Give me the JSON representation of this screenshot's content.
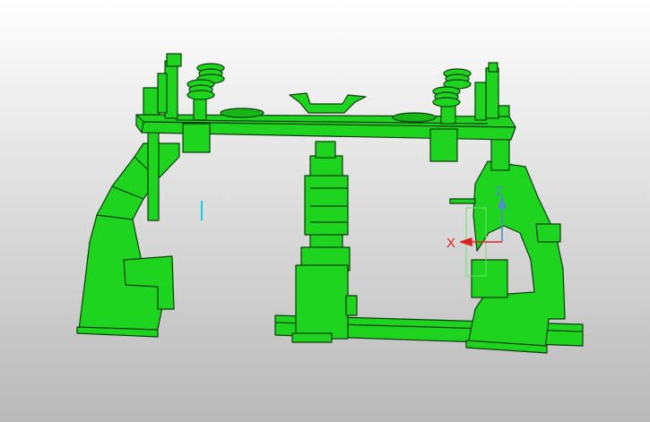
{
  "viewport": {
    "background_top": "#ffffff",
    "background_bottom": "#b9b9b9"
  },
  "model": {
    "body_color": "#1fd41f",
    "edge_color": "#0a3d0a"
  },
  "axis_triad": {
    "x_label": "X",
    "z_label": "Z",
    "x_color": "#e02020",
    "z_color": "#4a90c8"
  },
  "cursor": {
    "type": "text-cursor-icon",
    "color": "#22c8d8"
  }
}
